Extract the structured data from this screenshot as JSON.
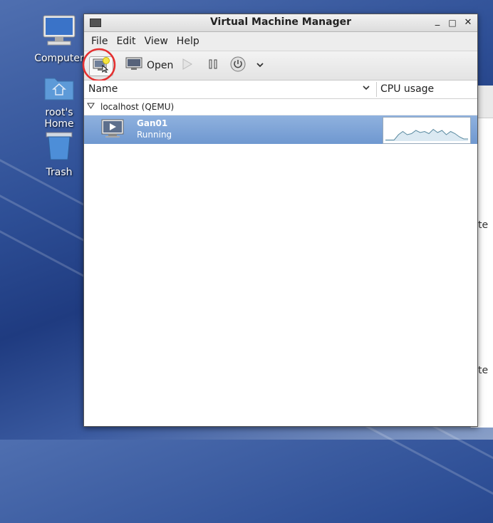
{
  "desktop": {
    "icons": [
      {
        "label": "Computer",
        "icon": "computer-icon"
      },
      {
        "label": "root's Home",
        "icon": "home-folder-icon"
      },
      {
        "label": "Trash",
        "icon": "trash-icon"
      }
    ],
    "bg_window_fragments": [
      "te",
      "te"
    ]
  },
  "window": {
    "title": "Virtual Machine Manager",
    "controls": {
      "minimize": "_",
      "maximize": "□",
      "close": "✕"
    }
  },
  "menu": {
    "file": "File",
    "edit": "Edit",
    "view": "View",
    "help": "Help"
  },
  "toolbar": {
    "new_vm_icon": "new-vm-icon",
    "open_label": "Open",
    "run_icon": "play-icon",
    "pause_icon": "pause-icon",
    "shutdown_icon": "power-icon",
    "dropdown_icon": "chevron-down-icon"
  },
  "columns": {
    "name": "Name",
    "cpu": "CPU usage"
  },
  "connection": {
    "label": "localhost (QEMU)"
  },
  "vms": [
    {
      "name": "Gan01",
      "status": "Running",
      "selected": true,
      "cpu_history": [
        0.05,
        0.05,
        0.05,
        0.3,
        0.45,
        0.3,
        0.35,
        0.5,
        0.4,
        0.45,
        0.35,
        0.55,
        0.4,
        0.5,
        0.3,
        0.45,
        0.35,
        0.2,
        0.1,
        0.1
      ]
    }
  ],
  "colors": {
    "selection": "#7ea3d6",
    "highlight_circle": "#e53030",
    "sparkline": "#5a8aa0"
  }
}
